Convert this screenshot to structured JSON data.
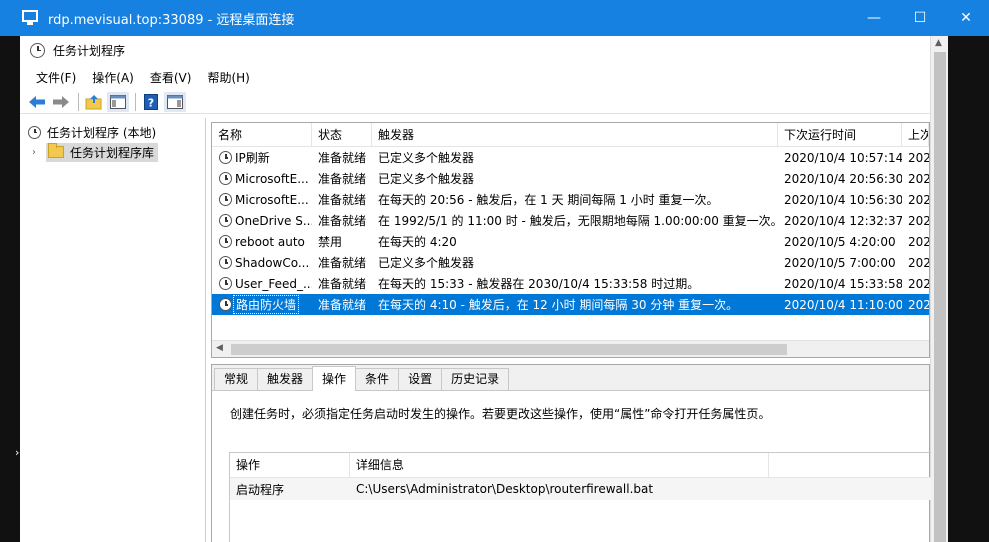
{
  "rdp": {
    "title": "rdp.mevisual.top:33089 - 远程桌面连接",
    "minimize": "—",
    "maximize": "☐",
    "close": "✕"
  },
  "app": {
    "title": "任务计划程序",
    "menu": [
      "文件(F)",
      "操作(A)",
      "查看(V)",
      "帮助(H)"
    ]
  },
  "tree": {
    "root_label": "任务计划程序 (本地)",
    "library_label": "任务计划程序库"
  },
  "task_list": {
    "columns": [
      "名称",
      "状态",
      "触发器",
      "下次运行时间",
      "上次"
    ],
    "rows": [
      {
        "name": "IP刷新",
        "status": "准备就绪",
        "trigger": "已定义多个触发器",
        "next_run": "2020/10/4 10:57:14",
        "last": "202"
      },
      {
        "name": "MicrosoftE...",
        "status": "准备就绪",
        "trigger": "已定义多个触发器",
        "next_run": "2020/10/4 20:56:30",
        "last": "202"
      },
      {
        "name": "MicrosoftE...",
        "status": "准备就绪",
        "trigger": "在每天的 20:56 - 触发后，在 1 天 期间每隔 1 小时 重复一次。",
        "next_run": "2020/10/4 10:56:30",
        "last": "202"
      },
      {
        "name": "OneDrive S...",
        "status": "准备就绪",
        "trigger": "在 1992/5/1 的 11:00 时 - 触发后，无限期地每隔 1.00:00:00 重复一次。",
        "next_run": "2020/10/4 12:32:37",
        "last": "202"
      },
      {
        "name": "reboot auto",
        "status": "禁用",
        "trigger": "在每天的 4:20",
        "next_run": "2020/10/5 4:20:00",
        "last": "202"
      },
      {
        "name": "ShadowCo...",
        "status": "准备就绪",
        "trigger": "已定义多个触发器",
        "next_run": "2020/10/5 7:00:00",
        "last": "202"
      },
      {
        "name": "User_Feed_...",
        "status": "准备就绪",
        "trigger": "在每天的 15:33 - 触发器在 2030/10/4 15:33:58 时过期。",
        "next_run": "2020/10/4 15:33:58",
        "last": "202"
      },
      {
        "name": "路由防火墙",
        "status": "准备就绪",
        "trigger": "在每天的 4:10 - 触发后，在 12 小时 期间每隔 30 分钟 重复一次。",
        "next_run": "2020/10/4 11:10:00",
        "last": "202"
      }
    ],
    "selected_index": 7
  },
  "detail": {
    "tabs": [
      "常规",
      "触发器",
      "操作",
      "条件",
      "设置",
      "历史记录"
    ],
    "active_tab": "操作",
    "description": "创建任务时，必须指定任务启动时发生的操作。若要更改这些操作，使用“属性”命令打开任务属性页。",
    "actions_columns": [
      "操作",
      "详细信息"
    ],
    "actions_rows": [
      {
        "action": "启动程序",
        "details": "C:\\Users\\Administrator\\Desktop\\routerfirewall.bat"
      }
    ]
  },
  "colors": {
    "rdp_titlebar": "#1681e0",
    "selection": "#0078d7"
  },
  "icons": {
    "back": "arrow-left-icon",
    "forward": "arrow-right-icon",
    "up": "folder-up-icon",
    "show_hide": "console-tree-icon",
    "help": "help-icon",
    "action_pane": "action-pane-icon",
    "task": "clock-icon"
  }
}
